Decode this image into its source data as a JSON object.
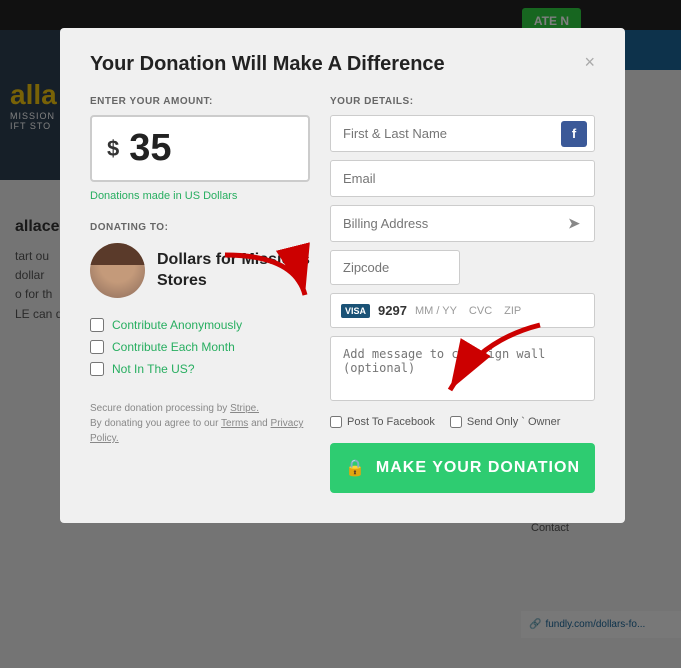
{
  "modal": {
    "title": "Your Donation Will Make A Difference",
    "close_label": "×",
    "amount_section": {
      "label": "ENTER YOUR AMOUNT:",
      "currency_symbol": "$",
      "amount": "35",
      "note": "Donations made in US Dollars"
    },
    "donating_to": {
      "label": "DONATING TO:",
      "recipient_name": "Dollars for Missions Stores"
    },
    "checkboxes": {
      "anonymous": "Contribute Anonymously",
      "monthly": "Contribute Each Month",
      "not_in_us": "Not In The US?"
    },
    "secure_note_line1": "Secure donation processing by",
    "stripe_label": "Stripe.",
    "secure_note_line2": "By donating you agree to our",
    "terms_label": "Terms",
    "and_label": "and",
    "privacy_label": "Privacy Policy."
  },
  "details": {
    "label": "YOUR DETAILS:",
    "name_placeholder": "First & Last Name",
    "email_placeholder": "Email",
    "address_placeholder": "Billing Address",
    "zip_placeholder": "Zipcode",
    "card_number": "9297",
    "card_mm_yy": "MM / YY",
    "card_cvc": "CVC",
    "card_zip": "ZIP",
    "message_placeholder": "Add message to campaign wall (optional)"
  },
  "share": {
    "facebook_label": "Post To Facebook",
    "owner_label": "Send Only ` Owner"
  },
  "donate_button": {
    "label": "MAKE YOUR DONATION"
  },
  "icons": {
    "facebook": "f",
    "location": "➤",
    "lock": "🔒",
    "visa": "VISA"
  }
}
